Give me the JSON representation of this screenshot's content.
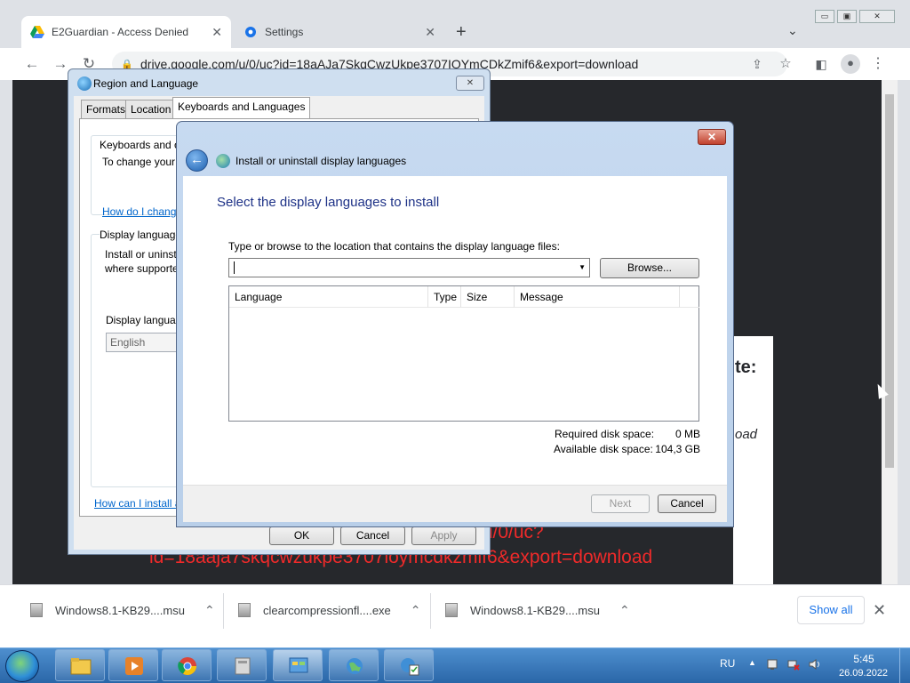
{
  "browser": {
    "tabs": [
      {
        "title": "E2Guardian - Access Denied",
        "icon": "google-drive-icon",
        "active": true
      },
      {
        "title": "Settings",
        "icon": "gear-icon",
        "active": false
      }
    ],
    "new_tab": "+",
    "tab_search": "⌄",
    "url": "drive.google.com/u/0/uc?id=18aAJa7SkqCwzUkpe3707IOYmCDkZmif6&export=download",
    "page_fragments": {
      "te": "te:",
      "oad": "oad",
      "red_line1": "/u/0/uc?",
      "red_line2": "id=18aaja7skqcwzukpe3707ioymcdkzmif6&export=download"
    },
    "downloads": [
      {
        "name": "Windows8.1-KB29....msu"
      },
      {
        "name": "clearcompressionfl....exe"
      },
      {
        "name": "Windows8.1-KB29....msu"
      }
    ],
    "show_all": "Show all",
    "close": "✕",
    "minimize": "▭",
    "restore": "▣",
    "window_close": "✕"
  },
  "region_dialog": {
    "title": "Region and Language",
    "tabs": [
      "Formats",
      "Location",
      "Keyboards and Languages"
    ],
    "selected_tab": "Keyboards and Languages",
    "group1_title": "Keyboards and o",
    "group1_text": "To change your",
    "group1_link": "How do I chang",
    "group2_title": "Display language",
    "group2_text1": "Install or uninst",
    "group2_text2": "where supporte",
    "display_language_label": "Display languag",
    "display_language_value": "English",
    "bottom_link": "How can I install a",
    "ok": "OK",
    "cancel": "Cancel",
    "apply": "Apply",
    "close": "✕"
  },
  "install_dialog": {
    "caption": "Install or uninstall display languages",
    "heading": "Select the display languages to install",
    "path_label": "Type or browse to the location that contains the display language files:",
    "path_value": "",
    "browse": "Browse...",
    "columns": [
      "Language",
      "Type",
      "Size",
      "Message"
    ],
    "rows": [],
    "required_label": "Required disk space:",
    "required_value": "0 MB",
    "available_label": "Available disk space:",
    "available_value": "104,3 GB",
    "next": "Next",
    "cancel": "Cancel",
    "close": "✕",
    "back": "←"
  },
  "taskbar": {
    "language": "RU",
    "time": "5:45",
    "date": "26.09.2022",
    "tray_up": "▲"
  }
}
